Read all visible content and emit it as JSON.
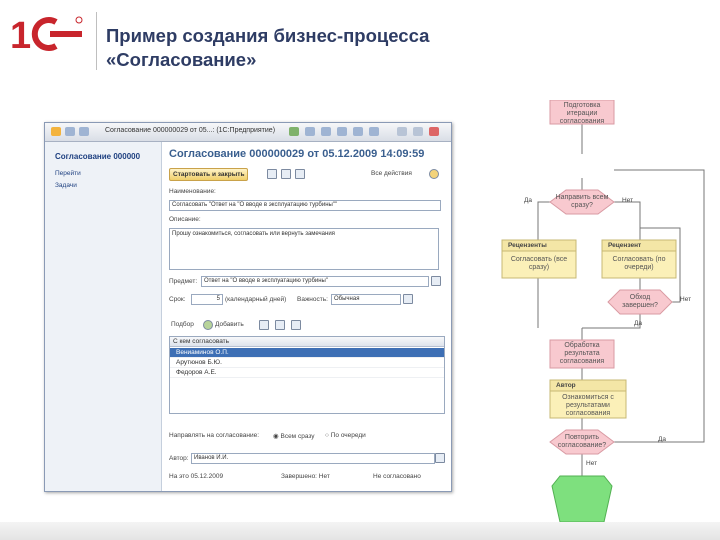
{
  "slide": {
    "logo_text": "1С",
    "title_line1": "Пример создания бизнес-процесса",
    "title_line2": "«Согласование»"
  },
  "window": {
    "title": "Согласование 000000029 от 05...: (1С:Предприятие)",
    "sidebar_title": "Согласование 000000",
    "sidebar_items": [
      "Перейти",
      "Задачи"
    ],
    "doc_title": "Согласование 000000029 от 05.12.2009 14:09:59",
    "toolbar": {
      "start_close": "Стартовать и закрыть",
      "all_actions": "Все действия"
    },
    "fields": {
      "name_label": "Наименование:",
      "name_value": "Согласовать \"Ответ на \"О вводе в эксплуатацию турбины\"\"",
      "desc_label": "Описание:",
      "desc_value": "Прошу ознакомиться, согласовать или вернуть замечания",
      "subject_label": "Предмет:",
      "subject_value": "Ответ на \"О вводе в эксплуатацию турбины\"",
      "term_label": "Срок:",
      "term_value": "5",
      "term_unit": "(календарный дней)",
      "importance_label": "Важность:",
      "importance_value": "Обычная"
    },
    "table_toolbar": {
      "pick": "Подбор",
      "add": "Добавить"
    },
    "table": {
      "header": "С кем согласовать",
      "rows": [
        "Вениаминов О.П.",
        "Арутюнов Б.Ю.",
        "Федоров А.Е."
      ]
    },
    "send_mode": {
      "label": "Направлять на согласование:",
      "option_all": "Всем сразу",
      "option_seq": "По очереди"
    },
    "author": {
      "label": "Автор:",
      "value": "Иванов И.И."
    },
    "status": {
      "started": "На это 05.12.2009",
      "finished": "Завершено: Нет",
      "state": "Не согласовано"
    }
  },
  "flowchart": {
    "nodes": {
      "prepare": "Подготовка итерации согласования",
      "send_all": "Направить всем сразу?",
      "reviewers": "Рецензенты",
      "reviewers_task": "Согласовать (все сразу)",
      "reviewer": "Рецензент",
      "reviewer_task": "Согласовать (по очереди)",
      "loop": "Обход завершен?",
      "process": "Обработка результата согласования",
      "author": "Автор",
      "author_task": "Ознакомиться с результатами согласования",
      "repeat": "Повторить согласование?"
    },
    "labels": {
      "yes1": "Да",
      "no1": "Нет",
      "no2": "Нет",
      "yes2": "Да",
      "yes3": "Да",
      "no3": "Нет"
    },
    "colors": {
      "pink": "#f8c9cf",
      "green": "#7ee07e",
      "yellow": "#fbf0b8"
    }
  }
}
